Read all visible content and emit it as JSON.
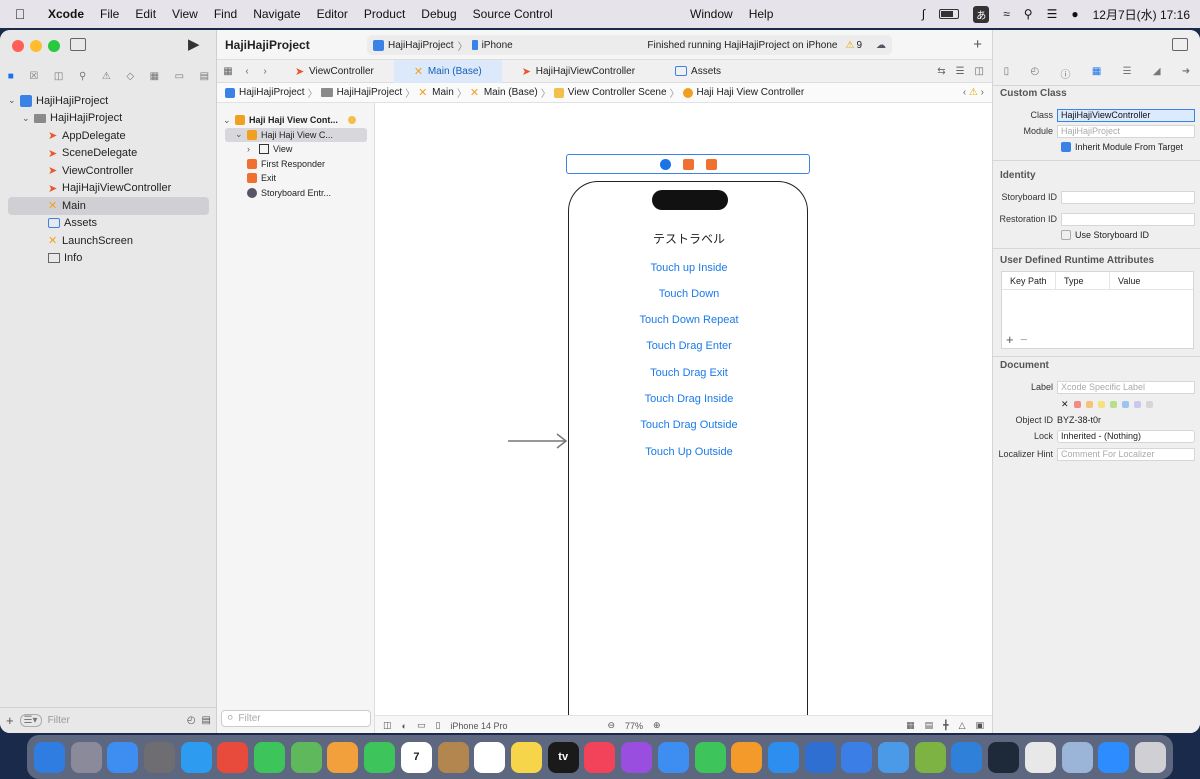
{
  "menubar": {
    "app": "Xcode",
    "items": [
      "File",
      "Edit",
      "View",
      "Find",
      "Navigate",
      "Editor",
      "Product",
      "Debug",
      "Source Control"
    ],
    "center_items": [
      "Window",
      "Help"
    ],
    "ime": "あ",
    "clock": "12月7日(水) 17:16"
  },
  "navigator": {
    "tree": [
      {
        "label": "HajiHajiProject",
        "kind": "project",
        "indent": 0,
        "chevron": "v"
      },
      {
        "label": "HajiHajiProject",
        "kind": "folder",
        "indent": 1,
        "chevron": "v"
      },
      {
        "label": "AppDelegate",
        "kind": "swift",
        "indent": 2
      },
      {
        "label": "SceneDelegate",
        "kind": "swift",
        "indent": 2
      },
      {
        "label": "ViewController",
        "kind": "swift",
        "indent": 2
      },
      {
        "label": "HajiHajiViewController",
        "kind": "swift",
        "indent": 2
      },
      {
        "label": "Main",
        "kind": "storyboard",
        "indent": 2,
        "selected": true
      },
      {
        "label": "Assets",
        "kind": "assets",
        "indent": 2
      },
      {
        "label": "LaunchScreen",
        "kind": "storyboard",
        "indent": 2
      },
      {
        "label": "Info",
        "kind": "plist",
        "indent": 2
      }
    ],
    "filter_placeholder": "Filter"
  },
  "toolbar": {
    "project_title": "HajiHajiProject",
    "scheme": "HajiHajiProject",
    "device": "iPhone",
    "status": "Finished running HajiHajiProject on iPhone",
    "warning_count": "9"
  },
  "tabs": [
    "ViewController",
    "Main (Base)",
    "HajiHajiViewController",
    "Assets"
  ],
  "active_tab": "Main (Base)",
  "breadcrumb": [
    "HajiHajiProject",
    "HajiHajiProject",
    "Main",
    "Main (Base)",
    "View Controller Scene",
    "Haji Haji View Controller"
  ],
  "outline": {
    "rows": [
      {
        "label": "Haji Haji View Cont...",
        "icon": "vc",
        "indent": 0,
        "chevron": "v",
        "bold": true
      },
      {
        "label": "Haji Haji View C...",
        "icon": "vc",
        "indent": 1,
        "chevron": "v",
        "selected": true
      },
      {
        "label": "View",
        "icon": "view",
        "indent": 2,
        "chevron": ">"
      },
      {
        "label": "First Responder",
        "icon": "fr",
        "indent": 1
      },
      {
        "label": "Exit",
        "icon": "exit",
        "indent": 1
      },
      {
        "label": "Storyboard Entr...",
        "icon": "segue",
        "indent": 1
      }
    ],
    "filter_placeholder": "Filter"
  },
  "canvas": {
    "label_text": "テストラベル",
    "buttons": [
      "Touch up Inside",
      "Touch Down",
      "Touch Down Repeat",
      "Touch Drag Enter",
      "Touch Drag Exit",
      "Touch Drag Inside",
      "Touch Drag Outside",
      "Touch Up Outside"
    ],
    "device_name": "iPhone 14 Pro",
    "zoom": "77%"
  },
  "inspector": {
    "custom_class_title": "Custom Class",
    "class_label": "Class",
    "class_value": "HajiHajiViewController",
    "module_label": "Module",
    "module_placeholder": "HajiHajiProject",
    "inherit_label": "Inherit Module From Target",
    "identity_title": "Identity",
    "storyboard_id_label": "Storyboard ID",
    "restoration_id_label": "Restoration ID",
    "use_storyboard_id_label": "Use Storyboard ID",
    "udra_title": "User Defined Runtime Attributes",
    "col_keypath": "Key Path",
    "col_type": "Type",
    "col_value": "Value",
    "document_title": "Document",
    "doc_label_label": "Label",
    "doc_label_placeholder": "Xcode Specific Label",
    "object_id_label": "Object ID",
    "object_id_value": "BYZ-38-t0r",
    "lock_label": "Lock",
    "lock_value": "Inherited - (Nothing)",
    "localizer_label": "Localizer Hint",
    "localizer_placeholder": "Comment For Localizer"
  },
  "colors": {
    "accent": "#3b82e6",
    "link": "#1a7ae8",
    "swatches": [
      "#f28b82",
      "#f7c27a",
      "#f5e27a",
      "#b9df8a",
      "#9cc4f2",
      "#c9c9f0",
      "#d6d6d6"
    ]
  },
  "dock": [
    {
      "name": "Finder",
      "color": "#2f7de1"
    },
    {
      "name": "Launchpad",
      "color": "#8a8a9a"
    },
    {
      "name": "Mail",
      "color": "#3d8ef0"
    },
    {
      "name": "System Settings",
      "color": "#6d6d72"
    },
    {
      "name": "Safari",
      "color": "#2d9cf0"
    },
    {
      "name": "Chrome",
      "color": "#e84a3c"
    },
    {
      "name": "Messages",
      "color": "#3dc45a"
    },
    {
      "name": "Maps",
      "color": "#5fb95c"
    },
    {
      "name": "Photos",
      "color": "#f2a03c"
    },
    {
      "name": "FaceTime",
      "color": "#3dc45a"
    },
    {
      "name": "Calendar",
      "color": "#ffffff",
      "text": "7"
    },
    {
      "name": "Contacts",
      "color": "#b38650"
    },
    {
      "name": "Reminders",
      "color": "#ffffff"
    },
    {
      "name": "Notes",
      "color": "#f7d54a"
    },
    {
      "name": "TV",
      "color": "#1a1a1a",
      "text": "tv"
    },
    {
      "name": "Music",
      "color": "#f2435a"
    },
    {
      "name": "Podcasts",
      "color": "#9a4ee0"
    },
    {
      "name": "Keynote",
      "color": "#3d8ef0"
    },
    {
      "name": "Numbers",
      "color": "#3dc45a"
    },
    {
      "name": "Pages",
      "color": "#f39a2a"
    },
    {
      "name": "App Store",
      "color": "#2d8ef0"
    },
    {
      "name": "Xcode",
      "color": "#2f6fd1"
    },
    {
      "name": "Simulator",
      "color": "#3a7ee6"
    },
    {
      "name": "Instruments",
      "color": "#4a9ae8"
    },
    {
      "name": "Script",
      "color": "#7cb342"
    },
    {
      "name": "VS Code",
      "color": "#2f80d9"
    },
    {
      "name": "GitHub",
      "color": "#1e2a3a"
    },
    {
      "name": "TextEdit",
      "color": "#e8e8e8"
    },
    {
      "name": "Preview",
      "color": "#9ab5d8"
    },
    {
      "name": "Zoom",
      "color": "#2d8cff"
    },
    {
      "name": "Trash",
      "color": "#cfcfd4"
    }
  ]
}
